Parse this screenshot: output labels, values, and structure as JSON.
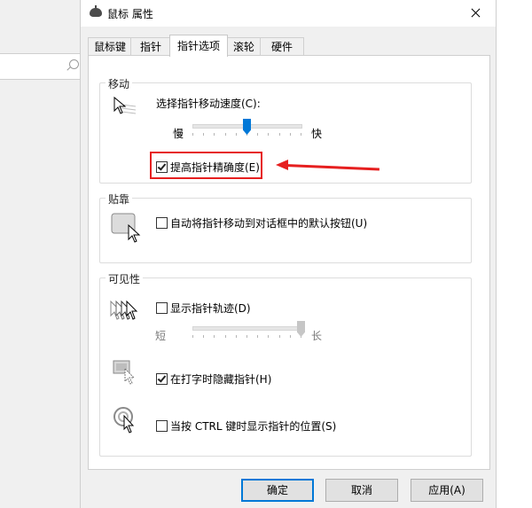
{
  "dialog": {
    "title": "鼠标 属性",
    "tabs": [
      {
        "label": "鼠标键"
      },
      {
        "label": "指针"
      },
      {
        "label": "指针选项"
      },
      {
        "label": "滚轮"
      },
      {
        "label": "硬件"
      }
    ],
    "active_tab": "指针选项"
  },
  "motion": {
    "group_title": "移动",
    "speed_label": "选择指针移动速度(C):",
    "slow_label": "慢",
    "fast_label": "快",
    "speed_level": 0.5,
    "precision_label": "提高指针精确度(E)",
    "precision_checked": true
  },
  "snap": {
    "group_title": "贴靠",
    "snap_label": "自动将指针移动到对话框中的默认按钮(U)",
    "snap_checked": false
  },
  "visibility": {
    "group_title": "可见性",
    "trails_label": "显示指针轨迹(D)",
    "trails_checked": false,
    "short_label": "短",
    "long_label": "长",
    "trail_level": 1.0,
    "hide_label": "在打字时隐藏指针(H)",
    "hide_checked": true,
    "ctrl_label": "当按 CTRL 键时显示指针的位置(S)",
    "ctrl_checked": false
  },
  "buttons": {
    "ok": "确定",
    "cancel": "取消",
    "apply": "应用(A)"
  },
  "colors": {
    "accent": "#0078d7",
    "annotation": "#e61f1f"
  }
}
